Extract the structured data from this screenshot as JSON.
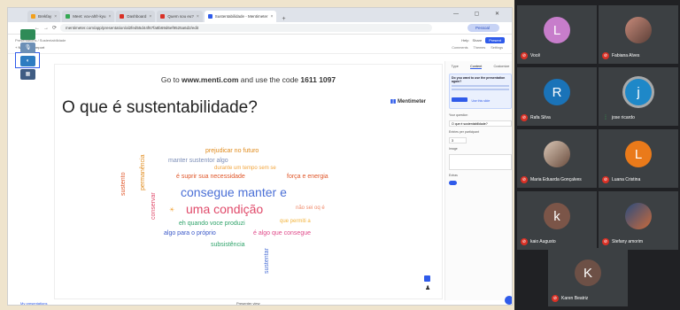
{
  "browser": {
    "tabs": [
      {
        "label": "Brekfay",
        "active": false
      },
      {
        "label": "Meet: vov-ahfr-kyu",
        "active": false
      },
      {
        "label": "Dashboard",
        "active": false
      },
      {
        "label": "Quem sou eu?",
        "active": false
      },
      {
        "label": "Sustentabilidade - Mentimeter",
        "active": true
      }
    ],
    "url": "mentimeter.com/app/presentation/al2fed55d44f67fa8b69d6ef9525a6d2/edit",
    "profile_label": "Pessoal",
    "window_controls": "— ▢ ✕"
  },
  "app": {
    "breadcrumb": "Presentations / Sustentabilidade",
    "toolbar_left": "+ New slide   Import",
    "right_actions": [
      "Help",
      "Share",
      "Present"
    ],
    "right_tabs": [
      "Comments",
      "Themes",
      "Settings"
    ]
  },
  "slide": {
    "instruction_prefix": "Go to ",
    "site": "www.menti.com",
    "instruction_mid": " and use the code ",
    "code": "1611 1097",
    "question": "O que é sustentabilidade?",
    "brand": "Mentimeter"
  },
  "wordcloud": [
    {
      "text": "prejudicar no futuro",
      "color": "#e08a1a",
      "size": 7
    },
    {
      "text": "manter sustentor algo",
      "color": "#7d8fb8",
      "size": 7
    },
    {
      "text": "durante um tempo sem se",
      "color": "#f2a43a",
      "size": 6
    },
    {
      "text": "é suprir sua necessidade",
      "color": "#e0572a",
      "size": 7
    },
    {
      "text": "força e energia",
      "color": "#e0572a",
      "size": 7
    },
    {
      "text": "consegue manter e",
      "color": "#4a6fd6",
      "size": 14
    },
    {
      "text": "uma condição",
      "color": "#e04a6a",
      "size": 14
    },
    {
      "text": "não sei oq é",
      "color": "#f08a6a",
      "size": 6
    },
    {
      "text": "eh quando voce produzi",
      "color": "#2fa36a",
      "size": 7
    },
    {
      "text": "que permiti a",
      "color": "#f2b33a",
      "size": 6
    },
    {
      "text": "algo para o próprio",
      "color": "#3a58c8",
      "size": 7
    },
    {
      "text": "é algo que consegue",
      "color": "#e04a8a",
      "size": 7
    },
    {
      "text": "subsistência",
      "color": "#2fa36a",
      "size": 7
    },
    {
      "text": "sustento",
      "color": "#e0572a",
      "size": 7
    },
    {
      "text": "permanência",
      "color": "#e08a1a",
      "size": 7
    },
    {
      "text": "conservar",
      "color": "#e04a6a",
      "size": 7
    },
    {
      "text": "sustentar",
      "color": "#4a6fd6",
      "size": 7
    }
  ],
  "right_panel": {
    "tabs": [
      "Type",
      "Content",
      "Customize"
    ],
    "tip_title": "Do you want to use the presentation again?",
    "tip_button": "Use this slide",
    "label_question": "Your question",
    "question_value": "O que é sustentabilidade?",
    "label_entries": "Entries per participant",
    "entries_value": "3",
    "label_image": "Image",
    "label_extras": "Extras"
  },
  "footer": {
    "left_link": "My presentations",
    "center": "Presenter view"
  },
  "participants": [
    {
      "name": "Você",
      "initial": "L",
      "color": "#c77dcb",
      "kind": "letter",
      "muted": true
    },
    {
      "name": "Fabiana Alves",
      "initial": "",
      "color": "",
      "kind": "photo",
      "muted": true
    },
    {
      "name": "Rafa Silva",
      "initial": "R",
      "color": "#1a73b8",
      "kind": "letter",
      "muted": true
    },
    {
      "name": "jose ricardo",
      "initial": "j",
      "color": "#1e88c8",
      "kind": "letter",
      "muted": false
    },
    {
      "name": "Maria Eduarda Gonçalves",
      "initial": "",
      "color": "",
      "kind": "photo2",
      "muted": true
    },
    {
      "name": "Luana Cristina",
      "initial": "L",
      "color": "#ea7a1a",
      "kind": "letter",
      "muted": true
    },
    {
      "name": "kaio Augusto",
      "initial": "k",
      "color": "#7b5548",
      "kind": "letter",
      "muted": true
    },
    {
      "name": "Stefany amorim",
      "initial": "",
      "color": "",
      "kind": "photo3",
      "muted": true
    },
    {
      "name": "Karen Beatriz",
      "initial": "K",
      "color": "#6d5046",
      "kind": "letter",
      "muted": true
    }
  ],
  "meet_left_icons": [
    "mic-icon",
    "camera-icon",
    "present-icon"
  ]
}
